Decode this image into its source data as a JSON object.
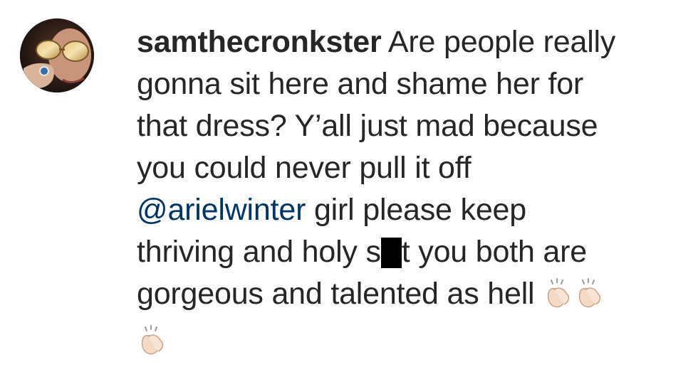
{
  "comment": {
    "username": "samthecronkster",
    "lines": [
      "Are people really",
      "gonna sit here and shame her for",
      "that dress? Y’all just mad because",
      "you could never pull it off"
    ],
    "mention": "@arielwinter",
    "mention_tail": "girl please keep",
    "line6_before": "thriving and holy s",
    "line6_after": "t you both are",
    "line7": "gorgeous and talented as hell",
    "emoji_name": "clapping-hands",
    "emoji_count": 3,
    "colors": {
      "text": "#262626",
      "mention": "#003569",
      "redaction": "#000000"
    }
  }
}
